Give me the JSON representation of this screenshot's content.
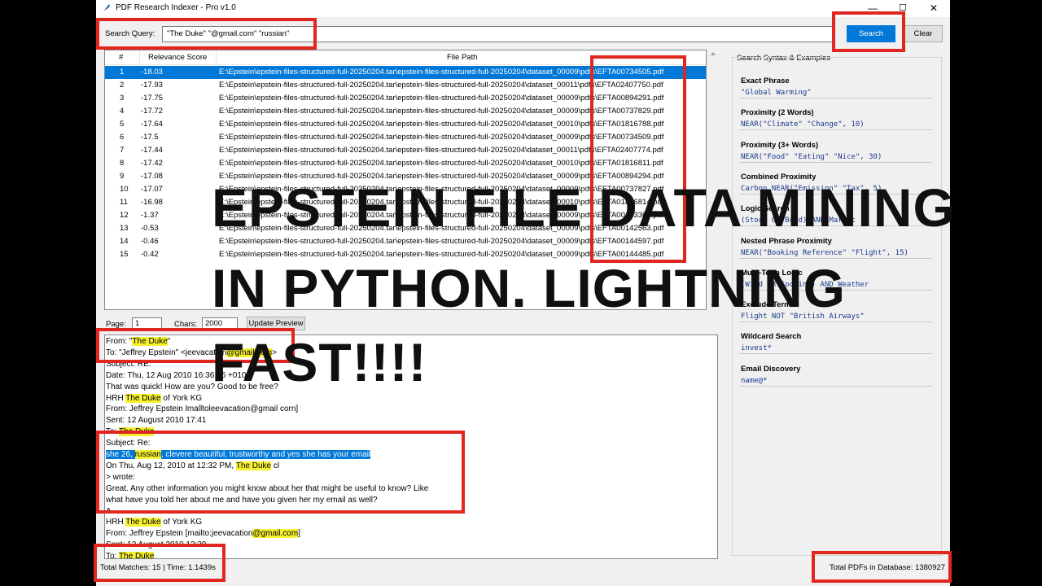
{
  "window": {
    "title": "PDF Research Indexer - Pro v1.0",
    "min": "—",
    "max": "☐",
    "close": "✕"
  },
  "search": {
    "label": "Search Query:",
    "value": "\"The Duke\" \"@gmail.com\" \"russian\"",
    "button": "Search",
    "clear": "Clear"
  },
  "table": {
    "headers": [
      "#",
      "Relevance Score",
      "File Path"
    ],
    "rows": [
      [
        "1",
        "-18.03",
        "E:\\Epstein\\epstein-files-structured-full-20250204.tar\\epstein-files-structured-full-20250204\\dataset_00009\\pdfs\\EFTA00734505.pdf"
      ],
      [
        "2",
        "-17.93",
        "E:\\Epstein\\epstein-files-structured-full-20250204.tar\\epstein-files-structured-full-20250204\\dataset_00011\\pdfs\\EFTA02407750.pdf"
      ],
      [
        "3",
        "-17.75",
        "E:\\Epstein\\epstein-files-structured-full-20250204.tar\\epstein-files-structured-full-20250204\\dataset_00009\\pdfs\\EFTA00894291.pdf"
      ],
      [
        "4",
        "-17.72",
        "E:\\Epstein\\epstein-files-structured-full-20250204.tar\\epstein-files-structured-full-20250204\\dataset_00009\\pdfs\\EFTA00737829.pdf"
      ],
      [
        "5",
        "-17.64",
        "E:\\Epstein\\epstein-files-structured-full-20250204.tar\\epstein-files-structured-full-20250204\\dataset_00010\\pdfs\\EFTA01816788.pdf"
      ],
      [
        "6",
        "-17.5",
        "E:\\Epstein\\epstein-files-structured-full-20250204.tar\\epstein-files-structured-full-20250204\\dataset_00009\\pdfs\\EFTA00734509.pdf"
      ],
      [
        "7",
        "-17.44",
        "E:\\Epstein\\epstein-files-structured-full-20250204.tar\\epstein-files-structured-full-20250204\\dataset_00011\\pdfs\\EFTA02407774.pdf"
      ],
      [
        "8",
        "-17.42",
        "E:\\Epstein\\epstein-files-structured-full-20250204.tar\\epstein-files-structured-full-20250204\\dataset_00010\\pdfs\\EFTA01816811.pdf"
      ],
      [
        "9",
        "-17.08",
        "E:\\Epstein\\epstein-files-structured-full-20250204.tar\\epstein-files-structured-full-20250204\\dataset_00009\\pdfs\\EFTA00894294.pdf"
      ],
      [
        "10",
        "-17.07",
        "E:\\Epstein\\epstein-files-structured-full-20250204.tar\\epstein-files-structured-full-20250204\\dataset_00009\\pdfs\\EFTA00737827.pdf"
      ],
      [
        "11",
        "-16.98",
        "E:\\Epstein\\epstein-files-structured-full-20250204.tar\\epstein-files-structured-full-20250204\\dataset_00010\\pdfs\\EFTA01816814.pdf"
      ],
      [
        "12",
        "-1.37",
        "E:\\Epstein\\epstein-files-structured-full-20250204.tar\\epstein-files-structured-full-20250204\\dataset_00009\\pdfs\\EFTA00143363.pdf"
      ],
      [
        "13",
        "-0.53",
        "E:\\Epstein\\epstein-files-structured-full-20250204.tar\\epstein-files-structured-full-20250204\\dataset_00009\\pdfs\\EFTA00142563.pdf"
      ],
      [
        "14",
        "-0.46",
        "E:\\Epstein\\epstein-files-structured-full-20250204.tar\\epstein-files-structured-full-20250204\\dataset_00009\\pdfs\\EFTA00144597.pdf"
      ],
      [
        "15",
        "-0.42",
        "E:\\Epstein\\epstein-files-structured-full-20250204.tar\\epstein-files-structured-full-20250204\\dataset_00009\\pdfs\\EFTA00144485.pdf"
      ]
    ]
  },
  "pager": {
    "page_label": "Page:",
    "page_value": "1",
    "chars_label": "Chars:",
    "chars_value": "2000",
    "update_button": "Update Preview"
  },
  "preview": {
    "lines": [
      [
        [
          "From: \"",
          ""
        ],
        [
          "The Duke",
          "hl"
        ],
        [
          "\"",
          ""
        ]
      ],
      [
        [
          "To: \"Jeffrey Epstein\" <jeevacation",
          ""
        ],
        [
          "@gmail.com",
          "hl"
        ],
        [
          ">",
          ""
        ]
      ],
      [
        [
          "Subject: RE:",
          ""
        ]
      ],
      [
        [
          "Date: Thu, 12 Aug 2010 16:36:56 +0100",
          ""
        ]
      ],
      [
        [
          "That was quick! How are you? Good to be free?",
          ""
        ]
      ],
      [
        [
          "HRH ",
          ""
        ],
        [
          "The Duke",
          "hl"
        ],
        [
          " of York KG",
          ""
        ]
      ],
      [
        [
          "From: Jeffrey Epstein lmalltoleevacation@gmail corn]",
          ""
        ]
      ],
      [
        [
          "Sent: 12 August 2010 17:41",
          ""
        ]
      ],
      [
        [
          "To: ",
          ""
        ],
        [
          "The Duke",
          "hl"
        ]
      ],
      [
        [
          "Subject: Re:",
          ""
        ]
      ],
      [
        [
          "she 26, ",
          "hlsel"
        ],
        [
          "russian",
          "hl"
        ],
        [
          ", clevere beautiful, trustworthy and yes she has your email",
          "hlsel"
        ]
      ],
      [
        [
          "On Thu, Aug 12, 2010 at 12:32 PM, ",
          ""
        ],
        [
          "The Duke",
          "hl"
        ],
        [
          " cl",
          ""
        ]
      ],
      [
        [
          "> wrote:",
          ""
        ]
      ],
      [
        [
          "Great. Any other information you might know about her that might be useful to know? Like",
          ""
        ]
      ],
      [
        [
          "what have you told her about me and have you given her my email as well?",
          ""
        ]
      ],
      [
        [
          "A",
          ""
        ]
      ],
      [
        [
          "HRH ",
          ""
        ],
        [
          "The Duke",
          "hl"
        ],
        [
          " of York KG",
          ""
        ]
      ],
      [
        [
          "From: Jeffrey Epstein [mailto:jeevacation",
          ""
        ],
        [
          "@gmail.com",
          "hl"
        ],
        [
          "]",
          ""
        ]
      ],
      [
        [
          "Sent: 12 August 2010 13:39",
          ""
        ]
      ],
      [
        [
          "To: ",
          ""
        ],
        [
          "The Duke",
          "hl"
        ]
      ]
    ]
  },
  "status": {
    "matches": "Total Matches: 15 | Time: 1.1439s",
    "total": "Total PDFs in Database: 1380927"
  },
  "sidebar": {
    "title": "Search Syntax & Examples",
    "items": [
      {
        "label": "Exact Phrase",
        "example": "\"Global Warming\""
      },
      {
        "label": "Proximity (2 Words)",
        "example": "NEAR(\"Climate\" \"Change\", 10)"
      },
      {
        "label": "Proximity (3+ Words)",
        "example": "NEAR(\"Food\" \"Eating\" \"Nice\", 30)"
      },
      {
        "label": "Combined Proximity",
        "example": "Carbon NEAR(\"Emission\" \"Tax\", 5)"
      },
      {
        "label": "Logic Search",
        "example": "(Stock OR Bond) AND Market"
      },
      {
        "label": "Nested Phrase Proximity",
        "example": "NEAR(\"Booking Reference\" \"Flight\", 15)"
      },
      {
        "label": "Multi-Term Logic",
        "example": "(Wind OR Cooling) AND Weather"
      },
      {
        "label": "Exclude Terms",
        "example": "Flight NOT \"British Airways\""
      },
      {
        "label": "Wildcard Search",
        "example": "invest*"
      },
      {
        "label": "Email Discovery",
        "example": "name@*"
      }
    ]
  },
  "overlay": {
    "line1": "EPSTEIN FILE DATA MINING",
    "line2": "IN PYTHON. LIGHTNING",
    "line3": "FAST!!!!"
  },
  "colors": {
    "highlight": "#f7f230",
    "selection": "#0078d7",
    "annotation": "#e0261f"
  }
}
